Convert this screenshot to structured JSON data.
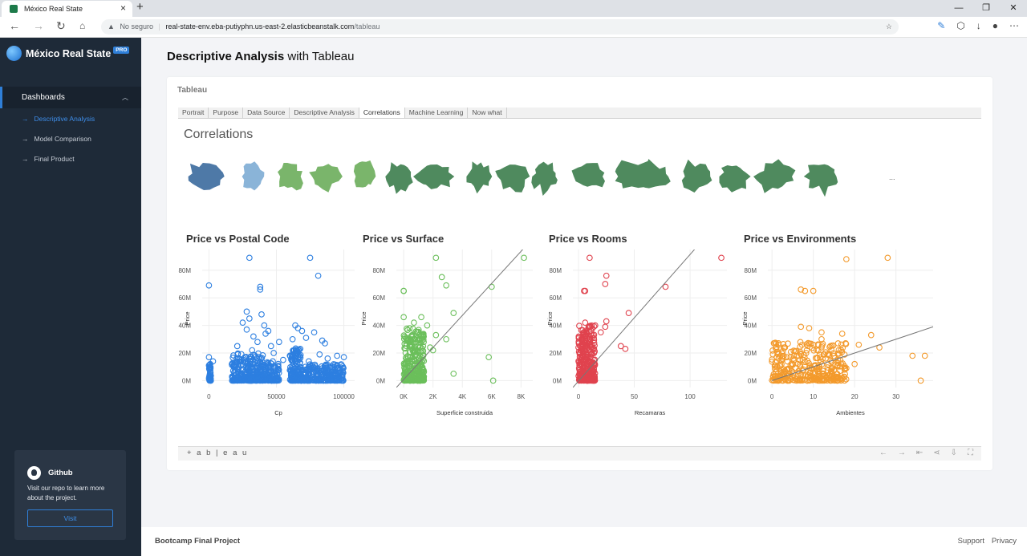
{
  "browser": {
    "tab_title": "México Real State",
    "security": "No seguro",
    "url_domain": "real-state-env.eba-putiyphn.us-east-2.elasticbeanstalk.com",
    "url_path": "/tableau"
  },
  "sidebar": {
    "brand": "México Real State",
    "badge": "PRO",
    "section": "Dashboards",
    "items": [
      {
        "label": "Descriptive Analysis",
        "active": true
      },
      {
        "label": "Model Comparison",
        "active": false
      },
      {
        "label": "Final Product",
        "active": false
      }
    ],
    "github": {
      "title": "Github",
      "text": "Visit our repo to learn more about the project.",
      "button": "Visit"
    }
  },
  "page": {
    "title_bold": "Descriptive Analysis",
    "title_rest": " with Tableau",
    "card_title": "Tableau"
  },
  "tableau": {
    "tabs": [
      "Portrait",
      "Purpose",
      "Data Source",
      "Descriptive Analysis",
      "Correlations",
      "Machine Learning",
      "Now what"
    ],
    "active_tab": "Correlations",
    "viz_title": "Correlations",
    "ellipsis": "...",
    "logo": "+ a b | e a u",
    "map_colors": [
      "#4e79a7",
      "#8ab4d8",
      "#7ab56b",
      "#7ab56b",
      "#7ab56b",
      "#4f8a5e",
      "#4f8a5e",
      "#4f8a5e",
      "#4f8a5e",
      "#4f8a5e",
      "#4f8a5e",
      "#4f8a5e",
      "#4f8a5e",
      "#4f8a5e",
      "#4f8a5e",
      "#4f8a5e",
      "#4f8a5e"
    ]
  },
  "footer": {
    "left": "Bootcamp Final Project",
    "links": [
      "Support",
      "Privacy"
    ]
  },
  "chart_data": [
    {
      "type": "scatter",
      "title": "Price vs Postal Code",
      "xlabel": "Cp",
      "ylabel": "Price",
      "xlim": [
        -5000,
        108000
      ],
      "ylim": [
        -5000000,
        95000000
      ],
      "xticks": [
        0,
        50000,
        100000
      ],
      "xtick_labels": [
        "0",
        "50000",
        "100000"
      ],
      "yticks": [
        0,
        20000000,
        40000000,
        60000000,
        80000000
      ],
      "ytick_labels": [
        "0M",
        "20M",
        "40M",
        "60M",
        "80M"
      ],
      "color": "#2d7fe0",
      "points": [
        [
          30000,
          89000000
        ],
        [
          75000,
          89000000
        ],
        [
          0,
          69000000
        ],
        [
          81000,
          76000000
        ],
        [
          38000,
          68000000
        ],
        [
          38000,
          66000000
        ],
        [
          28000,
          50000000
        ],
        [
          39000,
          48000000
        ],
        [
          30000,
          45000000
        ],
        [
          25000,
          42000000
        ],
        [
          41000,
          40000000
        ],
        [
          28000,
          37000000
        ],
        [
          44000,
          36000000
        ],
        [
          42000,
          34000000
        ],
        [
          33000,
          32000000
        ],
        [
          64000,
          40000000
        ],
        [
          66000,
          38000000
        ],
        [
          69000,
          36000000
        ],
        [
          78000,
          35000000
        ],
        [
          72000,
          31000000
        ],
        [
          84000,
          29000000
        ],
        [
          86000,
          27000000
        ],
        [
          62000,
          30000000
        ],
        [
          36000,
          28000000
        ],
        [
          52000,
          28000000
        ],
        [
          21000,
          25000000
        ],
        [
          46000,
          25000000
        ],
        [
          32000,
          22000000
        ],
        [
          0,
          17000000
        ],
        [
          0,
          11000000
        ],
        [
          48000,
          20000000
        ],
        [
          88000,
          16000000
        ],
        [
          95000,
          18000000
        ],
        [
          100000,
          17000000
        ],
        [
          3000,
          14000000
        ],
        [
          55000,
          15000000
        ],
        [
          65000,
          22000000
        ],
        [
          82000,
          19000000
        ],
        [
          17000,
          12000000
        ],
        [
          26000,
          16000000
        ],
        [
          74000,
          14000000
        ]
      ],
      "clusters": [
        [
          0,
          1500,
          0,
          15000000,
          35
        ],
        [
          17000,
          40000,
          0,
          20000000,
          260
        ],
        [
          40000,
          52000,
          0,
          14000000,
          110
        ],
        [
          60000,
          69000,
          0,
          24000000,
          160
        ],
        [
          70000,
          100000,
          0,
          12000000,
          240
        ]
      ]
    },
    {
      "type": "scatter",
      "title": "Price vs Surface",
      "xlabel": "Superficie construida",
      "ylabel": "Price",
      "xlim": [
        -500,
        8800
      ],
      "ylim": [
        -5000000,
        95000000
      ],
      "xticks": [
        0,
        2000,
        4000,
        6000,
        8000
      ],
      "xtick_labels": [
        "0K",
        "2K",
        "4K",
        "6K",
        "8K"
      ],
      "yticks": [
        0,
        20000000,
        40000000,
        60000000,
        80000000
      ],
      "ytick_labels": [
        "0M",
        "20M",
        "40M",
        "60M",
        "80M"
      ],
      "color": "#6bbf5b",
      "trend": [
        [
          -500,
          -5000000
        ],
        [
          8200,
          96000000
        ]
      ],
      "points": [
        [
          2200,
          89000000
        ],
        [
          8200,
          89000000
        ],
        [
          2600,
          75000000
        ],
        [
          2900,
          69000000
        ],
        [
          6000,
          68000000
        ],
        [
          0,
          65000000
        ],
        [
          0,
          65000000
        ],
        [
          3400,
          49000000
        ],
        [
          0,
          46000000
        ],
        [
          1200,
          46000000
        ],
        [
          700,
          42000000
        ],
        [
          1600,
          40000000
        ],
        [
          2200,
          33000000
        ],
        [
          2900,
          30000000
        ],
        [
          1800,
          24000000
        ],
        [
          5800,
          17000000
        ],
        [
          3400,
          5000000
        ],
        [
          6100,
          0
        ],
        [
          2000,
          22000000
        ],
        [
          900,
          35000000
        ],
        [
          400,
          38000000
        ]
      ],
      "clusters": [
        [
          0,
          1400,
          0,
          38000000,
          300
        ]
      ]
    },
    {
      "type": "scatter",
      "title": "Price vs Rooms",
      "xlabel": "Recamaras",
      "ylabel": "Price",
      "xlim": [
        -5,
        133
      ],
      "ylim": [
        -5000000,
        95000000
      ],
      "xticks": [
        0,
        50,
        100
      ],
      "xtick_labels": [
        "0",
        "50",
        "100"
      ],
      "yticks": [
        0,
        20000000,
        40000000,
        60000000,
        80000000
      ],
      "ytick_labels": [
        "0M",
        "20M",
        "40M",
        "60M",
        "80M"
      ],
      "color": "#e0434e",
      "trend": [
        [
          -5,
          -5000000
        ],
        [
          105,
          96000000
        ]
      ],
      "points": [
        [
          10,
          89000000
        ],
        [
          128,
          89000000
        ],
        [
          25,
          76000000
        ],
        [
          24,
          70000000
        ],
        [
          6,
          65000000
        ],
        [
          5,
          65000000
        ],
        [
          78,
          68000000
        ],
        [
          45,
          49000000
        ],
        [
          25,
          43000000
        ],
        [
          24,
          39000000
        ],
        [
          6,
          42000000
        ],
        [
          15,
          40000000
        ],
        [
          20,
          35000000
        ],
        [
          38,
          25000000
        ],
        [
          42,
          23000000
        ],
        [
          10,
          30000000
        ]
      ],
      "clusters": [
        [
          0,
          15,
          0,
          40000000,
          330
        ]
      ]
    },
    {
      "type": "scatter",
      "title": "Price vs Environments",
      "xlabel": "Ambientes",
      "ylabel": "Price",
      "xlim": [
        -1,
        39
      ],
      "ylim": [
        -5000000,
        95000000
      ],
      "xticks": [
        0,
        10,
        20,
        30
      ],
      "xtick_labels": [
        "0",
        "10",
        "20",
        "30"
      ],
      "yticks": [
        0,
        20000000,
        40000000,
        60000000,
        80000000
      ],
      "ytick_labels": [
        "0M",
        "20M",
        "40M",
        "60M",
        "80M"
      ],
      "color": "#f39a2c",
      "trend": [
        [
          0,
          0
        ],
        [
          40,
          40000000
        ]
      ],
      "points": [
        [
          28,
          89000000
        ],
        [
          18,
          88000000
        ],
        [
          7,
          66000000
        ],
        [
          8,
          65000000
        ],
        [
          10,
          65000000
        ],
        [
          7,
          39000000
        ],
        [
          9,
          38000000
        ],
        [
          12,
          35000000
        ],
        [
          17,
          34000000
        ],
        [
          24,
          33000000
        ],
        [
          12,
          30000000
        ],
        [
          16,
          27000000
        ],
        [
          21,
          26000000
        ],
        [
          26,
          24000000
        ],
        [
          34,
          18000000
        ],
        [
          37,
          18000000
        ],
        [
          15,
          18000000
        ],
        [
          20,
          12000000
        ],
        [
          36,
          0
        ],
        [
          18,
          9000000
        ]
      ],
      "clusters": [
        [
          0,
          18,
          0,
          28000000,
          330
        ]
      ]
    }
  ]
}
